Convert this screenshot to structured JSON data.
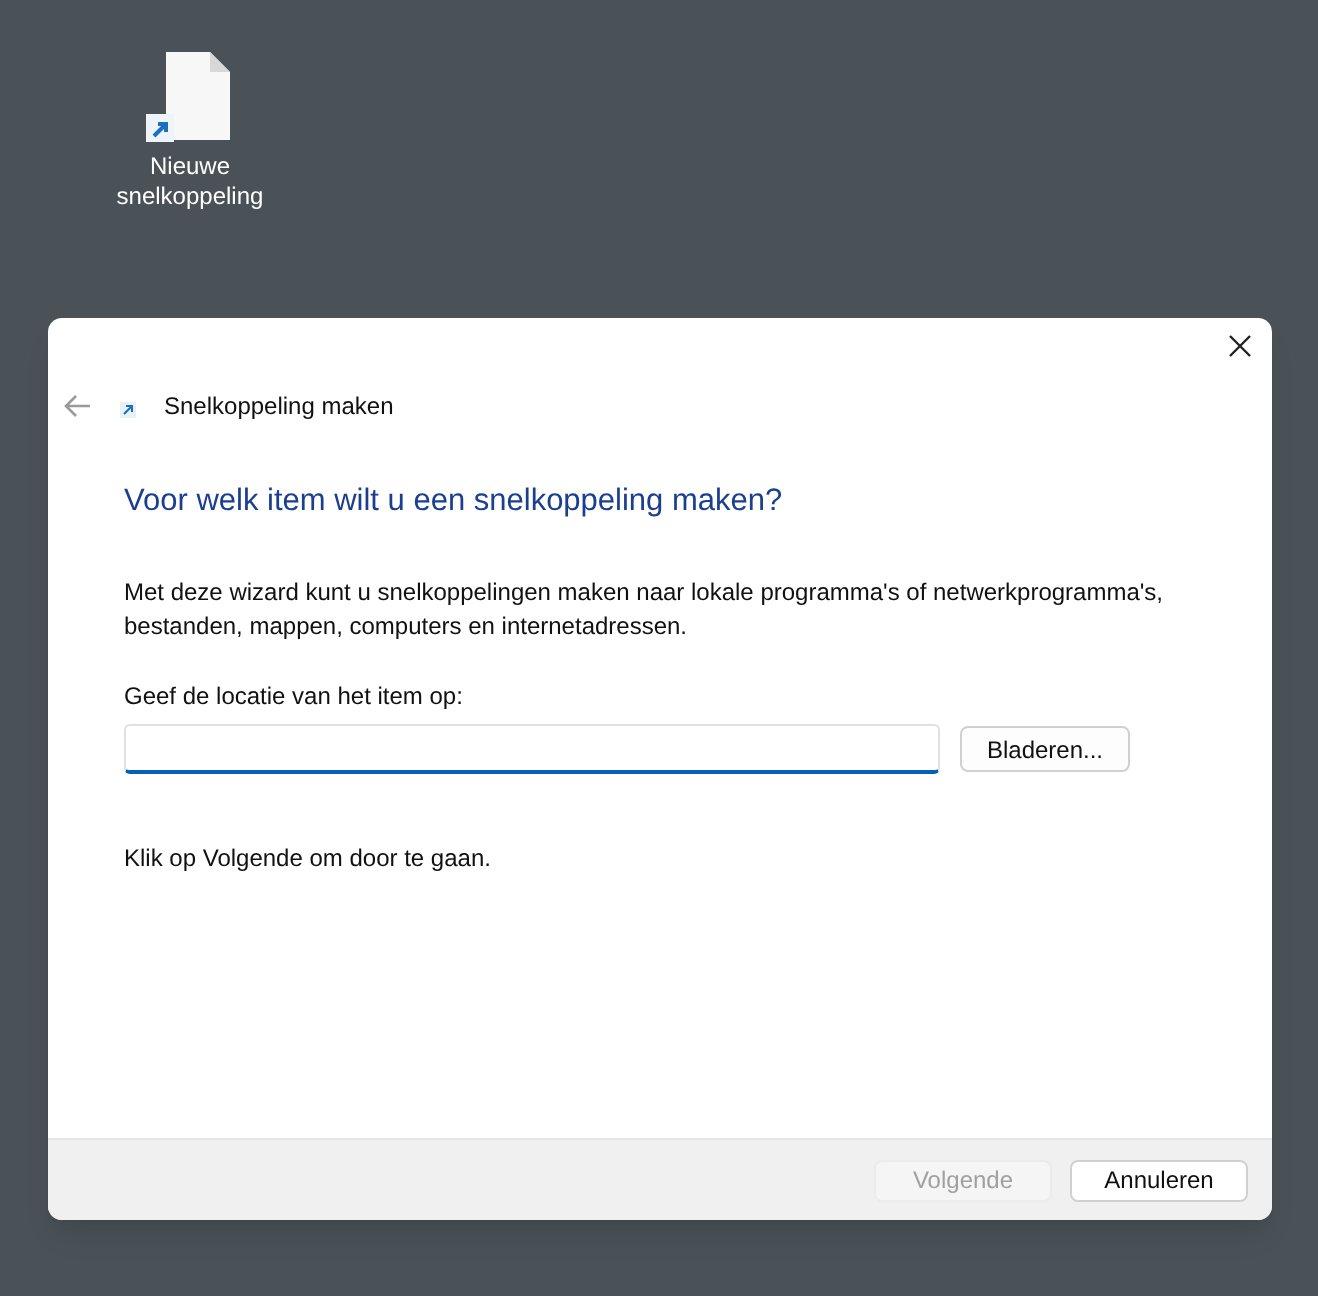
{
  "desktop_icon": {
    "label": "Nieuwe snelkoppeling"
  },
  "dialog": {
    "title": "Snelkoppeling maken",
    "heading": "Voor welk item wilt u een snelkoppeling maken?",
    "description": "Met deze wizard kunt u snelkoppelingen maken naar lokale programma's of netwerkprogramma's, bestanden, mappen, computers en internetadressen.",
    "location_label": "Geef de locatie van het item op:",
    "browse_button": "Bladeren...",
    "hint": "Klik op Volgende om door te gaan.",
    "buttons": [
      {
        "label": "Volgende",
        "disabled": true
      },
      {
        "label": "Annuleren",
        "disabled": false
      }
    ]
  }
}
